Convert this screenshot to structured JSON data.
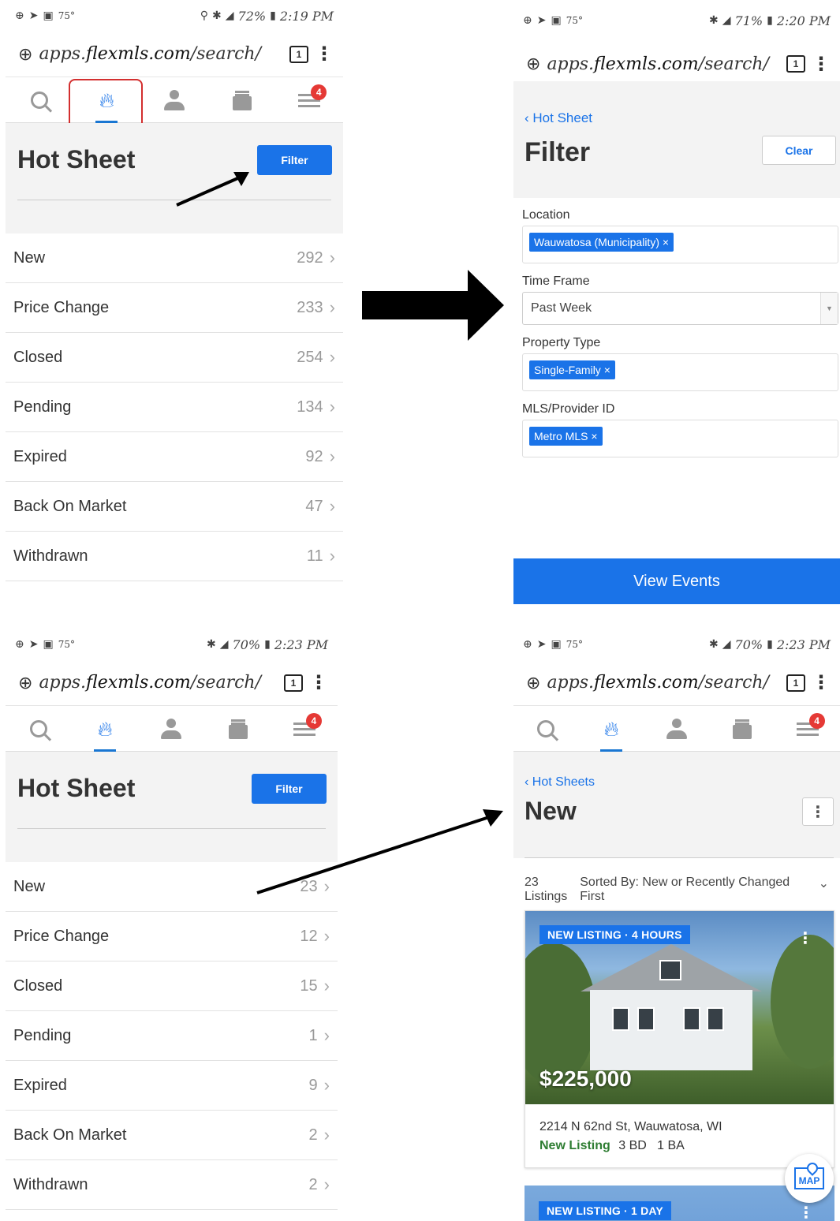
{
  "urlbar": {
    "prefix": "apps.",
    "domain": "flexmls.com",
    "path": "/search/",
    "tab_count": "1"
  },
  "nav": {
    "badge": "4"
  },
  "panel1": {
    "status": {
      "temp": "75°",
      "battery": "72%",
      "time": "2:19 PM"
    },
    "title": "Hot Sheet",
    "filter_label": "Filter",
    "rows": [
      {
        "label": "New",
        "count": "292"
      },
      {
        "label": "Price Change",
        "count": "233"
      },
      {
        "label": "Closed",
        "count": "254"
      },
      {
        "label": "Pending",
        "count": "134"
      },
      {
        "label": "Expired",
        "count": "92"
      },
      {
        "label": "Back On Market",
        "count": "47"
      },
      {
        "label": "Withdrawn",
        "count": "11"
      }
    ]
  },
  "panel2": {
    "status": {
      "temp": "75°",
      "battery": "71%",
      "time": "2:20 PM"
    },
    "back_label": "Hot Sheet",
    "title": "Filter",
    "clear_label": "Clear",
    "location_label": "Location",
    "location_chip": "Wauwatosa (Municipality) ×",
    "timeframe_label": "Time Frame",
    "timeframe_value": "Past Week",
    "property_label": "Property Type",
    "property_chip": "Single-Family ×",
    "mls_label": "MLS/Provider ID",
    "mls_chip": "Metro MLS ×",
    "view_events": "View Events"
  },
  "panel3": {
    "status": {
      "temp": "75°",
      "battery": "70%",
      "time": "2:23 PM"
    },
    "title": "Hot Sheet",
    "filter_label": "Filter",
    "rows": [
      {
        "label": "New",
        "count": "23"
      },
      {
        "label": "Price Change",
        "count": "12"
      },
      {
        "label": "Closed",
        "count": "15"
      },
      {
        "label": "Pending",
        "count": "1"
      },
      {
        "label": "Expired",
        "count": "9"
      },
      {
        "label": "Back On Market",
        "count": "2"
      },
      {
        "label": "Withdrawn",
        "count": "2"
      }
    ]
  },
  "panel4": {
    "status": {
      "temp": "75°",
      "battery": "70%",
      "time": "2:23 PM"
    },
    "back_label": "Hot Sheets",
    "title": "New",
    "listing_count": "23",
    "listing_word": "Listings",
    "sort_text": "Sorted By: New or Recently Changed First",
    "card1": {
      "tag": "NEW LISTING · 4 HOURS",
      "price": "$225,000",
      "address": "2214 N 62nd St, Wauwatosa, WI",
      "status": "New Listing",
      "beds": "3 BD",
      "baths": "1 BA"
    },
    "card2": {
      "tag": "NEW LISTING · 1 DAY"
    },
    "map_label": "MAP"
  },
  "colors": {
    "accent": "#1a73e8",
    "badge": "#e53935",
    "highlight": "#d32f2f",
    "status_new": "#2e7d32"
  }
}
